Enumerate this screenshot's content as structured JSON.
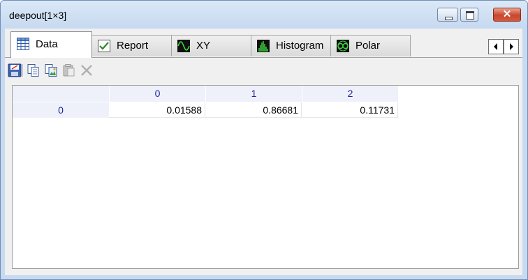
{
  "window": {
    "title": "deepout[1×3]",
    "close_symbol": "✕"
  },
  "tabs": [
    {
      "label": "Data",
      "icon": "table-icon",
      "active": true
    },
    {
      "label": "Report",
      "icon": "checkbox-report-icon",
      "active": false
    },
    {
      "label": "XY",
      "icon": "xy-wave-icon",
      "active": false
    },
    {
      "label": "Histogram",
      "icon": "histogram-icon",
      "active": false
    },
    {
      "label": "Polar",
      "icon": "polar-icon",
      "active": false
    }
  ],
  "toolbar": {
    "icons": [
      "save-icon",
      "copy-icon",
      "copy-image-icon",
      "paste-icon",
      "delete-icon"
    ]
  },
  "grid": {
    "column_headers": [
      "0",
      "1",
      "2"
    ],
    "rows": [
      {
        "header": "0",
        "cells": [
          "0.01588",
          "0.86681",
          "0.11731"
        ]
      }
    ]
  },
  "colors": {
    "title_bg": "#c6d9f0",
    "header_bg": "#eef0fa",
    "header_text": "#1f1fa0",
    "close_button": "#c9462c"
  }
}
